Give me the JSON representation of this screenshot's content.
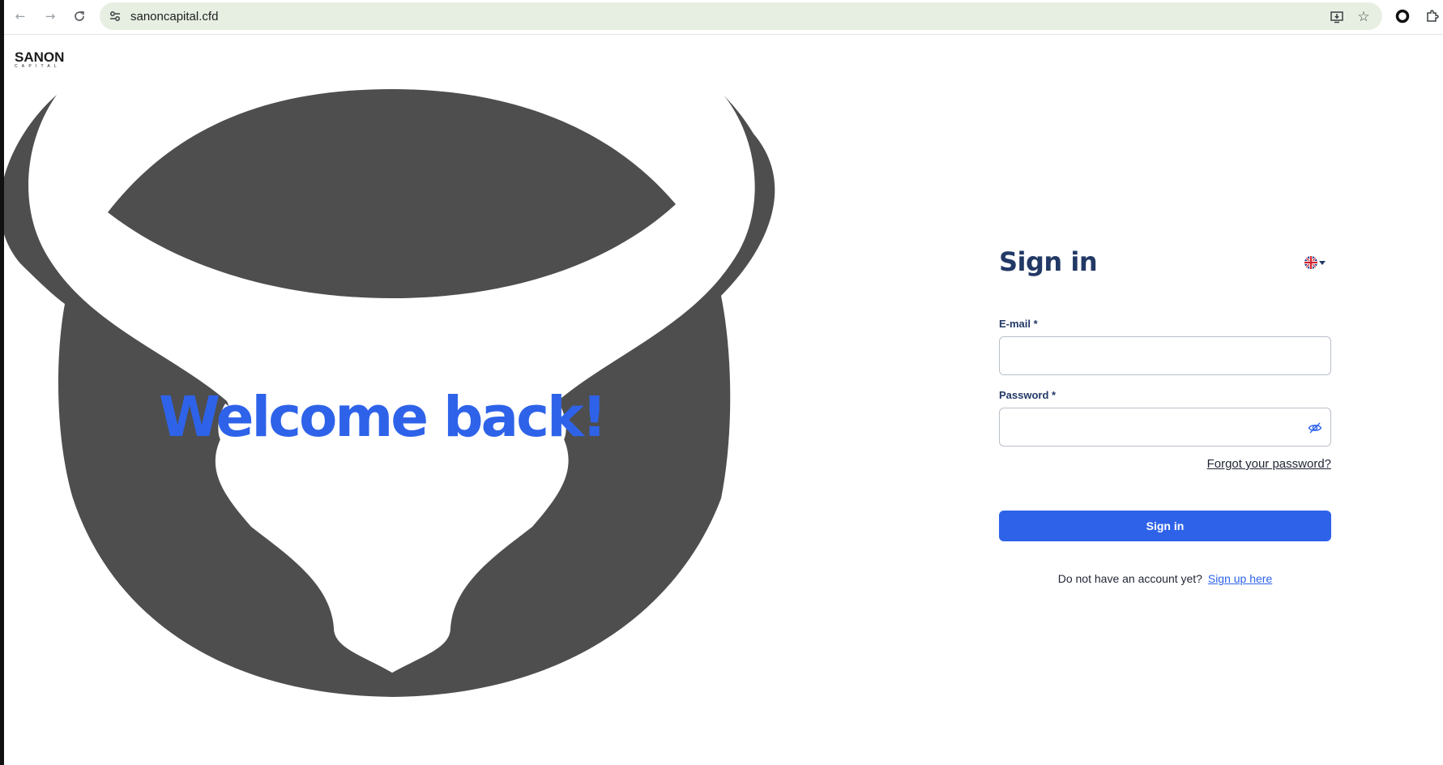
{
  "browser": {
    "url": "sanoncapital.cfd",
    "icons": {
      "back": "arrow-left-icon",
      "forward": "arrow-right-icon",
      "reload": "reload-icon",
      "site_info": "tune-icon",
      "install": "install-app-icon",
      "bookmark": "star-icon",
      "extension": "circle-extension-icon",
      "extensions_menu": "puzzle-icon"
    }
  },
  "brand": {
    "name": "SANON",
    "sub": "CAPITAL"
  },
  "hero": {
    "welcome_text": "Welcome back!"
  },
  "signin": {
    "title": "Sign in",
    "language_flag": "uk-flag-icon",
    "email_label": "E-mail *",
    "email_value": "",
    "password_label": "Password *",
    "password_value": "",
    "forgot_password": "Forgot your password?",
    "submit_label": "Sign in",
    "no_account_text": "Do not have an account yet?",
    "signup_link": "Sign up here"
  },
  "colors": {
    "accent": "#2e63e9",
    "heading": "#223966",
    "bull": "#4e4e4e",
    "omnibox": "#e7efe3"
  }
}
